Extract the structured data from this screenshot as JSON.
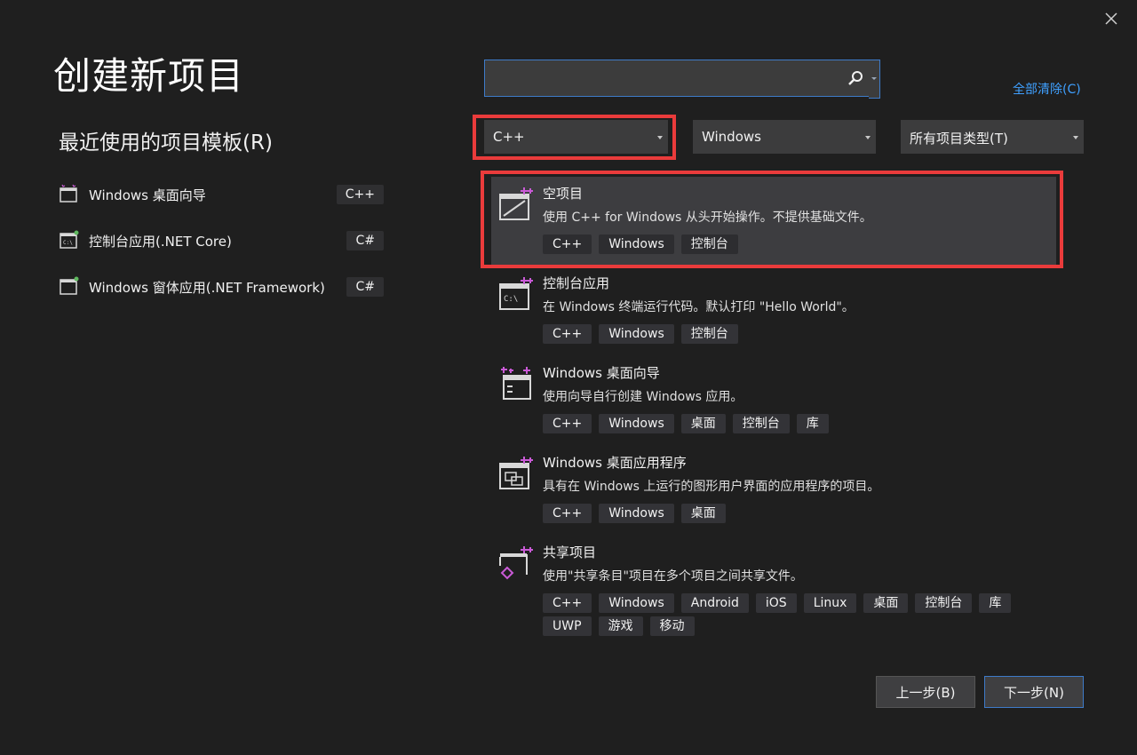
{
  "window": {
    "title": "创建新项目",
    "close_icon": "close-icon"
  },
  "recent": {
    "title": "最近使用的项目模板(R)",
    "items": [
      {
        "name": "Windows 桌面向导",
        "lang": "C++",
        "icon": "windows-desktop-wizard-icon"
      },
      {
        "name": "控制台应用(.NET Core)",
        "lang": "C#",
        "icon": "console-app-icon"
      },
      {
        "name": "Windows 窗体应用(.NET Framework)",
        "lang": "C#",
        "icon": "windows-forms-icon"
      }
    ]
  },
  "search": {
    "value": "",
    "placeholder": "",
    "icon": "search-icon"
  },
  "clear_all": "全部清除(C)",
  "filters": {
    "language": "C++",
    "platform": "Windows",
    "project_type": "所有项目类型(T)"
  },
  "templates": [
    {
      "name": "空项目",
      "description": "使用 C++ for Windows 从头开始操作。不提供基础文件。",
      "tags": [
        "C++",
        "Windows",
        "控制台"
      ],
      "icon": "empty-project-icon",
      "selected": true
    },
    {
      "name": "控制台应用",
      "description": "在 Windows 终端运行代码。默认打印 \"Hello World\"。",
      "tags": [
        "C++",
        "Windows",
        "控制台"
      ],
      "icon": "console-app-icon"
    },
    {
      "name": "Windows 桌面向导",
      "description": "使用向导自行创建 Windows 应用。",
      "tags": [
        "C++",
        "Windows",
        "桌面",
        "控制台",
        "库"
      ],
      "icon": "windows-desktop-wizard-icon"
    },
    {
      "name": "Windows 桌面应用程序",
      "description": "具有在 Windows 上运行的图形用户界面的应用程序的项目。",
      "tags": [
        "C++",
        "Windows",
        "桌面"
      ],
      "icon": "windows-desktop-app-icon"
    },
    {
      "name": "共享项目",
      "description": "使用\"共享条目\"项目在多个项目之间共享文件。",
      "tags": [
        "C++",
        "Windows",
        "Android",
        "iOS",
        "Linux",
        "桌面",
        "控制台",
        "库",
        "UWP",
        "游戏",
        "移动"
      ],
      "icon": "shared-project-icon"
    }
  ],
  "buttons": {
    "back": "上一步(B)",
    "next": "下一步(N)"
  },
  "colors": {
    "background": "#1f1f1f",
    "accent": "#3e7bc9",
    "link": "#3fa0ff",
    "highlight": "#ea3b3b",
    "icon_accent": "#c95ad6"
  }
}
